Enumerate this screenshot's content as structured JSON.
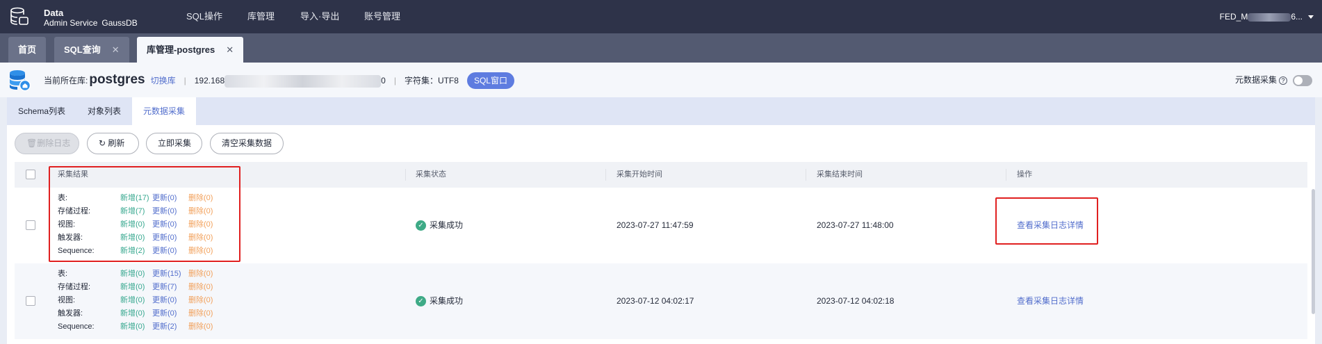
{
  "header": {
    "brand_line1": "Data",
    "brand_line2": "Admin Service",
    "brand_product": "GaussDB",
    "nav": [
      "SQL操作",
      "库管理",
      "导入·导出",
      "账号管理"
    ],
    "user_prefix": "FED_M",
    "user_suffix": "6..."
  },
  "page_tabs": [
    {
      "label": "首页",
      "closable": false
    },
    {
      "label": "SQL查询",
      "closable": true
    },
    {
      "label": "库管理-postgres",
      "closable": true,
      "active": true
    }
  ],
  "close_glyph": "✕",
  "info": {
    "current_db_label": "当前所在库:",
    "db_name": "postgres",
    "switch_db": "切换库",
    "ip_prefix": "192.168",
    "ip_suffix": "0",
    "charset": "字符集：UTF8",
    "sql_window": "SQL窗口",
    "metadata_collect_label": "元数据采集",
    "metadata_collect_enabled": false
  },
  "sub_tabs": [
    "Schema列表",
    "对象列表",
    "元数据采集"
  ],
  "toolbar": {
    "delete_log": "删除日志",
    "refresh": "刷新",
    "collect_now": "立即采集",
    "clear_data": "清空采集数据"
  },
  "table": {
    "columns": [
      "采集结果",
      "采集状态",
      "采集开始时间",
      "采集结束时间",
      "操作"
    ],
    "rows": [
      {
        "results": [
          {
            "label": "表:",
            "add": "新增(17)",
            "update": "更新(0)",
            "delete": "删除(0)"
          },
          {
            "label": "存储过程:",
            "add": "新增(7)",
            "update": "更新(0)",
            "delete": "删除(0)"
          },
          {
            "label": "视图:",
            "add": "新增(0)",
            "update": "更新(0)",
            "delete": "删除(0)"
          },
          {
            "label": "触发器:",
            "add": "新增(0)",
            "update": "更新(0)",
            "delete": "删除(0)"
          },
          {
            "label": "Sequence:",
            "add": "新增(2)",
            "update": "更新(0)",
            "delete": "删除(0)"
          }
        ],
        "status": "采集成功",
        "start_time": "2023-07-27 11:47:59",
        "end_time": "2023-07-27 11:48:00",
        "action": "查看采集日志详情"
      },
      {
        "results": [
          {
            "label": "表:",
            "add": "新增(0)",
            "update": "更新(15)",
            "delete": "删除(0)"
          },
          {
            "label": "存储过程:",
            "add": "新增(0)",
            "update": "更新(7)",
            "delete": "删除(0)"
          },
          {
            "label": "视图:",
            "add": "新增(0)",
            "update": "更新(0)",
            "delete": "删除(0)"
          },
          {
            "label": "触发器:",
            "add": "新增(0)",
            "update": "更新(0)",
            "delete": "删除(0)"
          },
          {
            "label": "Sequence:",
            "add": "新增(0)",
            "update": "更新(2)",
            "delete": "删除(0)"
          }
        ],
        "status": "采集成功",
        "start_time": "2023-07-12 04:02:17",
        "end_time": "2023-07-12 04:02:18",
        "action": "查看采集日志详情"
      }
    ]
  },
  "colors": {
    "add": "#37a88f",
    "update": "#526ecc",
    "delete": "#f2a05a",
    "highlight": "#e02020"
  }
}
